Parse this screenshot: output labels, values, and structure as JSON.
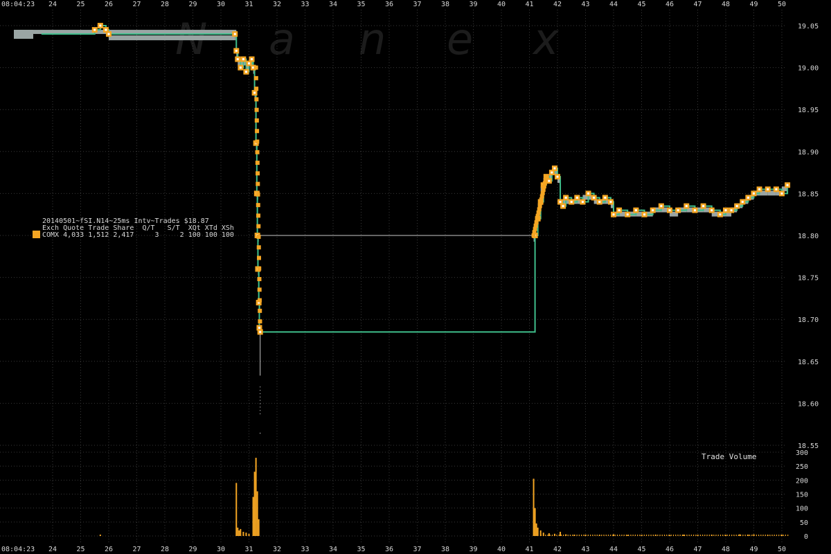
{
  "time_label": "08:04:23",
  "watermark_letters": [
    "N",
    "a",
    "n",
    "e",
    "x"
  ],
  "info": {
    "title": "20140501~fSI.N14~25ms Intv~Trades $18.87",
    "header": "Exch Quote Trade Share  Q/T   S/T  XQt XTd XSh",
    "row": "COMX 4,033 1,512 2,417     3     2 100 100 100"
  },
  "colors": {
    "background": "#000000",
    "trade": "#f5a623",
    "bid_ask_band": "#9aa5a4",
    "nbbo_line": "#3fbf8c",
    "grid": "#3a3a3a",
    "thin_line": "#c8c8c8"
  },
  "chart_data": [
    {
      "type": "line",
      "title": "20140501~fSI.N14~25ms Intv~Trades $18.87",
      "x_unit": "seconds after 08:04",
      "x_ticks": [
        24,
        25,
        26,
        27,
        28,
        29,
        30,
        31,
        32,
        33,
        34,
        35,
        36,
        37,
        38,
        39,
        40,
        41,
        42,
        43,
        44,
        45,
        46,
        47,
        48,
        49,
        50
      ],
      "xlim": [
        23.6,
        50.4
      ],
      "ylim": [
        18.545,
        19.06
      ],
      "y_ticks": [
        "19.05",
        "19.00",
        "18.95",
        "18.90",
        "18.85",
        "18.80",
        "18.75",
        "18.70",
        "18.65",
        "18.60",
        "18.55"
      ],
      "grid": true,
      "series": [
        {
          "name": "COMX",
          "points": [
            [
              23.6,
              19.04
            ],
            [
              25.5,
              19.045
            ],
            [
              25.7,
              19.05
            ],
            [
              25.9,
              19.045
            ],
            [
              26.0,
              19.04
            ],
            [
              30.5,
              19.04
            ],
            [
              30.55,
              19.02
            ],
            [
              30.6,
              19.01
            ],
            [
              30.7,
              19.0
            ],
            [
              30.8,
              19.01
            ],
            [
              30.9,
              18.995
            ],
            [
              31.0,
              19.005
            ],
            [
              31.1,
              19.01
            ],
            [
              31.15,
              19.0
            ],
            [
              31.2,
              18.97
            ],
            [
              31.25,
              18.91
            ],
            [
              31.28,
              18.85
            ],
            [
              31.3,
              18.8
            ],
            [
              31.32,
              18.76
            ],
            [
              31.35,
              18.72
            ],
            [
              31.37,
              18.69
            ],
            [
              31.4,
              18.685
            ],
            [
              41.15,
              18.685
            ],
            [
              41.2,
              18.8
            ],
            [
              41.3,
              18.82
            ],
            [
              41.4,
              18.84
            ],
            [
              41.5,
              18.86
            ],
            [
              41.6,
              18.87
            ],
            [
              41.7,
              18.865
            ],
            [
              41.8,
              18.875
            ],
            [
              41.9,
              18.88
            ],
            [
              42.0,
              18.87
            ],
            [
              42.1,
              18.84
            ],
            [
              42.2,
              18.835
            ],
            [
              42.3,
              18.845
            ],
            [
              42.5,
              18.84
            ],
            [
              42.7,
              18.845
            ],
            [
              42.9,
              18.84
            ],
            [
              43.1,
              18.85
            ],
            [
              43.3,
              18.845
            ],
            [
              43.5,
              18.84
            ],
            [
              43.7,
              18.845
            ],
            [
              43.9,
              18.84
            ],
            [
              44.0,
              18.825
            ],
            [
              44.2,
              18.83
            ],
            [
              44.5,
              18.825
            ],
            [
              44.8,
              18.83
            ],
            [
              45.1,
              18.825
            ],
            [
              45.4,
              18.83
            ],
            [
              45.7,
              18.835
            ],
            [
              46.0,
              18.83
            ],
            [
              46.3,
              18.83
            ],
            [
              46.6,
              18.835
            ],
            [
              46.9,
              18.83
            ],
            [
              47.2,
              18.835
            ],
            [
              47.5,
              18.83
            ],
            [
              47.8,
              18.825
            ],
            [
              48.0,
              18.83
            ],
            [
              48.2,
              18.83
            ],
            [
              48.4,
              18.835
            ],
            [
              48.6,
              18.84
            ],
            [
              48.8,
              18.845
            ],
            [
              49.0,
              18.85
            ],
            [
              49.2,
              18.855
            ],
            [
              49.5,
              18.855
            ],
            [
              49.8,
              18.855
            ],
            [
              50.0,
              18.85
            ],
            [
              50.2,
              18.86
            ]
          ]
        }
      ]
    },
    {
      "type": "bar",
      "title": "Trade Volume",
      "ylim": [
        0,
        300
      ],
      "y_ticks": [
        "300",
        "250",
        "200",
        "150",
        "100",
        "50",
        "0"
      ],
      "bars": [
        [
          25.7,
          5
        ],
        [
          30.55,
          190
        ],
        [
          30.6,
          30
        ],
        [
          30.65,
          20
        ],
        [
          30.7,
          25
        ],
        [
          30.8,
          15
        ],
        [
          30.9,
          12
        ],
        [
          31.0,
          8
        ],
        [
          31.15,
          140
        ],
        [
          31.2,
          230
        ],
        [
          31.25,
          280
        ],
        [
          31.3,
          160
        ],
        [
          31.35,
          60
        ],
        [
          41.15,
          205
        ],
        [
          41.2,
          100
        ],
        [
          41.25,
          45
        ],
        [
          41.3,
          30
        ],
        [
          41.4,
          20
        ],
        [
          41.5,
          12
        ],
        [
          41.7,
          10
        ],
        [
          41.9,
          8
        ],
        [
          42.1,
          15
        ],
        [
          42.3,
          6
        ],
        [
          42.6,
          5
        ],
        [
          43.0,
          5
        ],
        [
          43.5,
          4
        ],
        [
          44.0,
          6
        ],
        [
          44.5,
          4
        ],
        [
          45.0,
          4
        ],
        [
          45.5,
          5
        ],
        [
          46.0,
          4
        ],
        [
          46.5,
          5
        ],
        [
          47.0,
          4
        ],
        [
          47.5,
          5
        ],
        [
          48.0,
          4
        ],
        [
          48.5,
          6
        ],
        [
          48.8,
          5
        ],
        [
          49.0,
          6
        ],
        [
          49.5,
          4
        ],
        [
          50.0,
          5
        ]
      ]
    }
  ]
}
